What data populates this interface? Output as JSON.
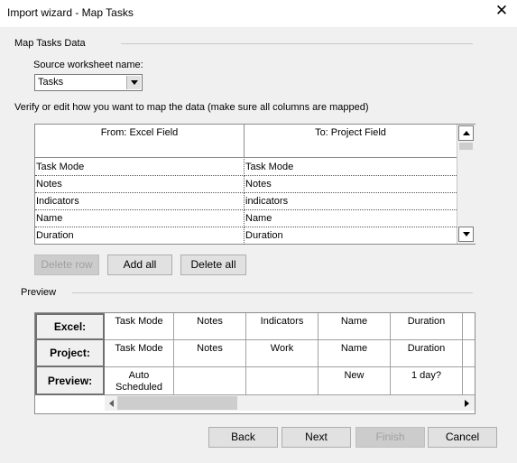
{
  "window": {
    "title": "Import wizard - Map Tasks",
    "close_icon": "close-icon"
  },
  "section_mapdata": {
    "label": "Map Tasks Data"
  },
  "source": {
    "label": "Source worksheet name:",
    "value": "Tasks"
  },
  "verify_text": "Verify or edit how you want to map the data (make sure all columns are mapped)",
  "mapping": {
    "head_from": "From: Excel Field",
    "head_to": "To: Project Field",
    "rows": [
      {
        "from": "Task Mode",
        "to": "Task Mode"
      },
      {
        "from": "Notes",
        "to": "Notes"
      },
      {
        "from": "Indicators",
        "to": "indicators"
      },
      {
        "from": "Name",
        "to": "Name"
      },
      {
        "from": "Duration",
        "to": "Duration"
      }
    ]
  },
  "row_buttons": {
    "delete_row": "Delete row",
    "add_all": "Add all",
    "delete_all": "Delete all"
  },
  "preview": {
    "label": "Preview",
    "row_headers": {
      "excel": "Excel:",
      "project": "Project:",
      "preview": "Preview:"
    },
    "excel": [
      "Task Mode",
      "Notes",
      "Indicators",
      "Name",
      "Duration"
    ],
    "project": [
      "Task Mode",
      "Notes",
      "Work",
      "Name",
      "Duration"
    ],
    "preview": [
      "Auto Scheduled",
      "",
      "",
      "New",
      "1 day?"
    ]
  },
  "footer": {
    "back": "Back",
    "next": "Next",
    "finish": "Finish",
    "cancel": "Cancel"
  }
}
